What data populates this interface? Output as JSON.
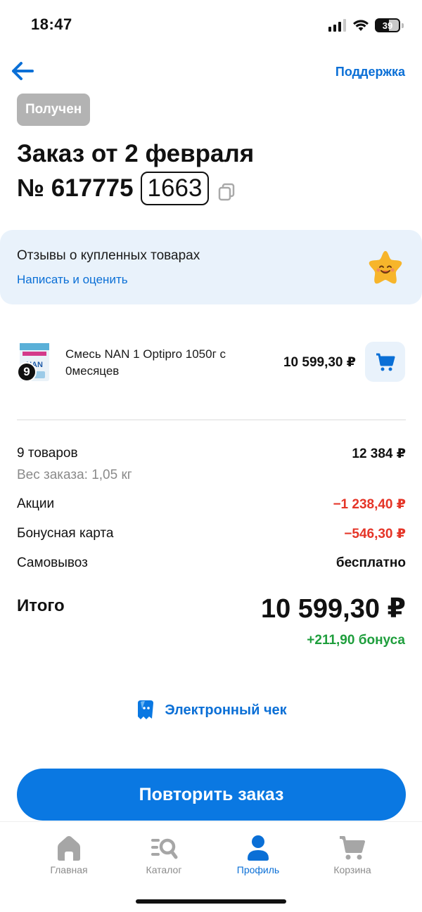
{
  "status_bar": {
    "time": "18:47",
    "battery": "39"
  },
  "header": {
    "back_icon": "arrow-left-icon",
    "support_label": "Поддержка"
  },
  "order": {
    "status": "Получен",
    "title": "Заказ от 2 февраля",
    "number_prefix": "№ 617775",
    "number_code": "1663"
  },
  "review": {
    "title": "Отзывы о купленных товарах",
    "link": "Написать и оценить"
  },
  "items": [
    {
      "qty": "9",
      "name": "Смесь NAN 1 Optipro 1050г с 0месяцев",
      "price": "10 599,30 ₽",
      "thumb_text": "NAN"
    }
  ],
  "summary": {
    "goods_label": "9 товаров",
    "goods_value": "12 384 ₽",
    "weight": "Вес заказа: 1,05 кг",
    "promo_label": "Акции",
    "promo_value": "−1 238,40 ₽",
    "bonus_card_label": "Бонусная карта",
    "bonus_card_value": "−546,30 ₽",
    "pickup_label": "Самовывоз",
    "pickup_value": "бесплатно",
    "total_label": "Итого",
    "total_value": "10 599,30 ₽",
    "bonus_earned": "+211,90 бонуса"
  },
  "receipt": {
    "label": "Электронный чек"
  },
  "actions": {
    "repeat_label": "Повторить заказ"
  },
  "tabbar": [
    {
      "label": "Главная",
      "icon": "home-icon",
      "active": false
    },
    {
      "label": "Каталог",
      "icon": "catalog-search-icon",
      "active": false
    },
    {
      "label": "Профиль",
      "icon": "profile-icon",
      "active": true
    },
    {
      "label": "Корзина",
      "icon": "cart-icon",
      "active": false
    }
  ],
  "colors": {
    "accent": "#0a78e2",
    "link": "#0a6fd6",
    "discount": "#e53528",
    "bonus": "#1e9e3c",
    "badge": "#b3b3b3"
  }
}
